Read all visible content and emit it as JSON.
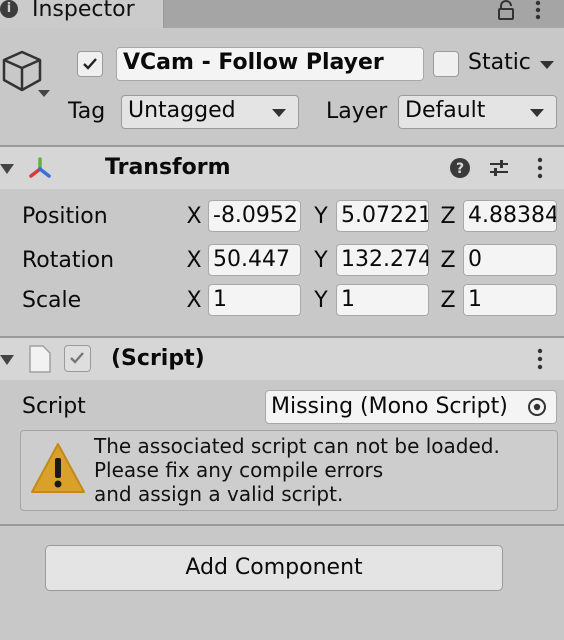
{
  "tab": {
    "title": "Inspector",
    "info_icon": "i"
  },
  "header": {
    "active": true,
    "name": "VCam - Follow Player",
    "static_label": "Static",
    "static_checked": false,
    "tag_label": "Tag",
    "tag_value": "Untagged",
    "layer_label": "Layer",
    "layer_value": "Default"
  },
  "transform": {
    "title": "Transform",
    "rows": [
      {
        "label": "Position",
        "x": "-8.0952",
        "y": "5.07221",
        "z": "4.88384"
      },
      {
        "label": "Rotation",
        "x": "50.447",
        "y": "132.2745",
        "z": "0"
      },
      {
        "label": "Scale",
        "x": "1",
        "y": "1",
        "z": "1"
      }
    ],
    "axes": {
      "x": "X",
      "y": "Y",
      "z": "Z"
    }
  },
  "script_component": {
    "title": "(Script)",
    "enabled": true,
    "field_label": "Script",
    "field_value": "Missing (Mono Script)",
    "warning_lines": [
      "The associated script can not be loaded.",
      "Please fix any compile errors",
      "and assign a valid script."
    ]
  },
  "add_component_label": "Add Component",
  "colors": {
    "warning": "#d9a02a",
    "axis_x": "#d93b3b",
    "axis_y": "#5fb236",
    "axis_z": "#3b6fd9"
  }
}
